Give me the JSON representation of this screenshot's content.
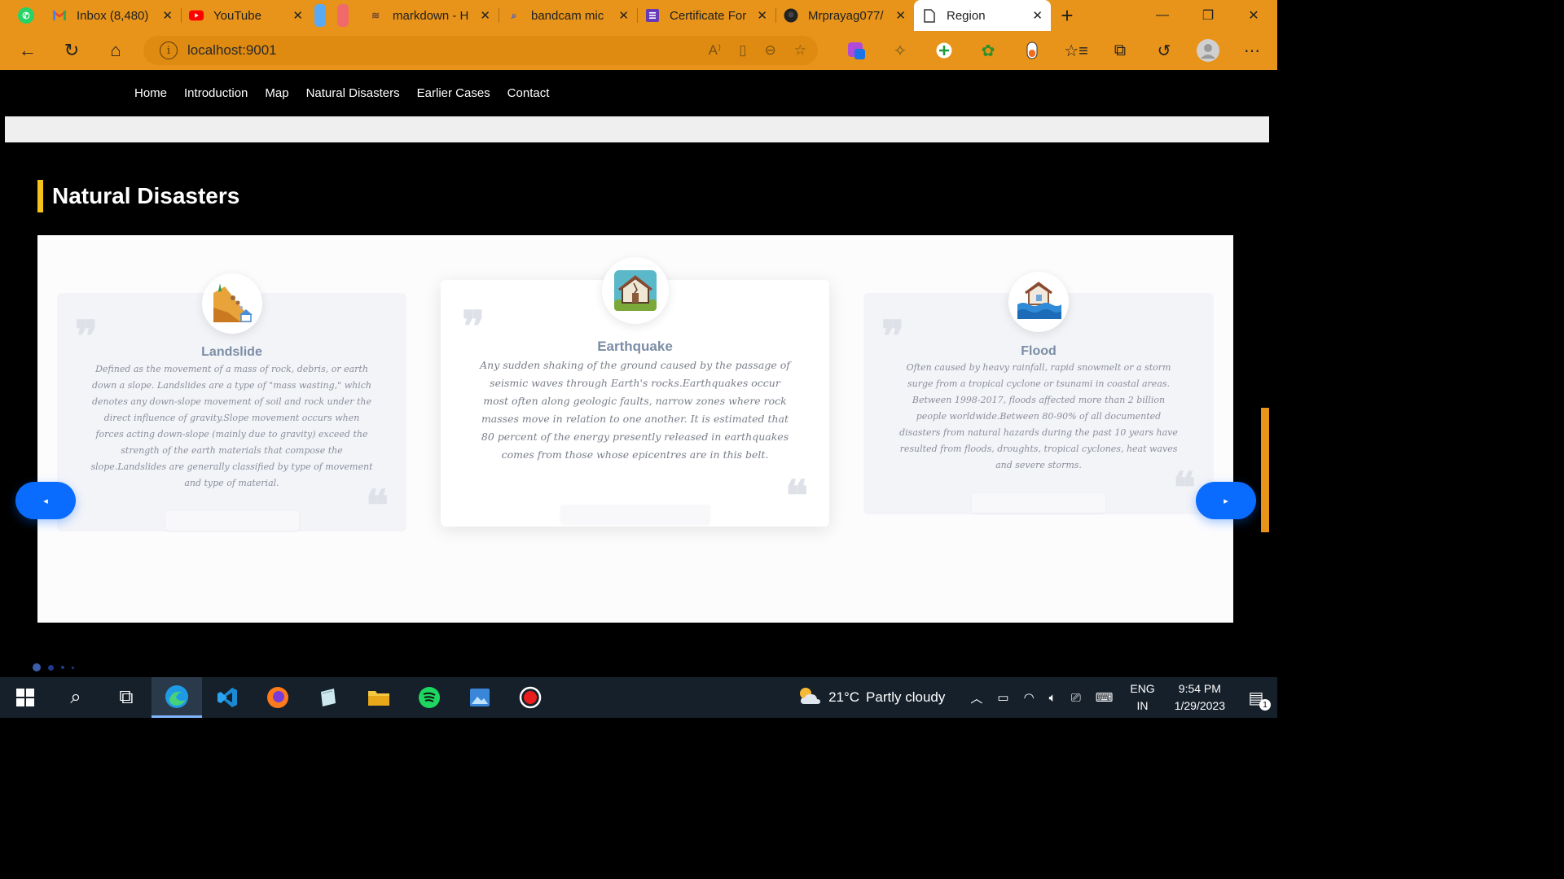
{
  "browser": {
    "tabs": [
      {
        "title": "",
        "icon": "whatsapp-icon"
      },
      {
        "title": "Inbox (8,480)",
        "icon": "gmail-icon"
      },
      {
        "title": "YouTube",
        "icon": "youtube-icon"
      },
      {
        "title": "markdown - H",
        "icon": "stack-overflow-icon"
      },
      {
        "title": "bandcam mic",
        "icon": "search-icon"
      },
      {
        "title": "Certificate For",
        "icon": "forms-icon"
      },
      {
        "title": "Mrprayag077/",
        "icon": "github-icon"
      },
      {
        "title": "Region",
        "icon": "page-icon",
        "active": true
      }
    ],
    "url": "localhost:9001",
    "accent_color": "#e8941a"
  },
  "site": {
    "nav": [
      "Home",
      "Introduction",
      "Map",
      "Natural Disasters",
      "Earlier Cases",
      "Contact"
    ],
    "section_title": "Natural Disasters",
    "section_accent": "#f5c31a",
    "cards": [
      {
        "title": "Landslide",
        "icon": "landslide-icon",
        "text": "Defined as the movement of a mass of rock, debris, or earth down a slope. Landslides are a type of \"mass wasting,\" which denotes any down-slope movement of soil and rock under the direct influence of gravity.Slope movement occurs when forces acting down-slope (mainly due to gravity) exceed the strength of the earth materials that compose the slope.Landslides are generally classified by type of movement and type of material."
      },
      {
        "title": "Earthquake",
        "icon": "earthquake-house-icon",
        "text": "Any sudden shaking of the ground caused by the passage of seismic waves through Earth's rocks.Earthquakes occur most often along geologic faults, narrow zones where rock masses move in relation to one another. It is estimated that 80 percent of the energy presently released in earthquakes comes from those whose epicentres are in this belt."
      },
      {
        "title": "Flood",
        "icon": "flood-icon",
        "text": "Often caused by heavy rainfall, rapid snowmelt or a storm surge from a tropical cyclone or tsunami in coastal areas. Between 1998-2017, floods affected more than 2 billion people worldwide.Between 80-90% of all documented disasters from natural hazards during the past 10 years have resulted from floods, droughts, tropical cyclones, heat waves and severe storms."
      }
    ],
    "slider": {
      "prev_icon": "caret-left-icon",
      "next_icon": "caret-right-icon",
      "dot_count": 4,
      "active_dot": 0,
      "arrow_color": "#0a6cff"
    }
  },
  "taskbar": {
    "weather_temp": "21°C",
    "weather_text": "Partly cloudy",
    "lang_top": "ENG",
    "lang_bottom": "IN",
    "time": "9:54 PM",
    "date": "1/29/2023",
    "notifications": "1"
  }
}
